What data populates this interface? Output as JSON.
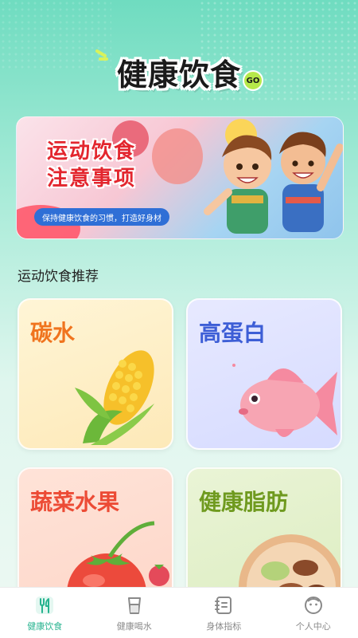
{
  "header": {
    "title": "健康饮食",
    "badge": "GO"
  },
  "banner": {
    "title_line1": "运动饮食",
    "title_line2": "注意事项",
    "subtitle": "保持健康饮食的习惯，打造好身材"
  },
  "section": {
    "title": "运动饮食推荐"
  },
  "cards": [
    {
      "label": "碳水",
      "icon": "corn"
    },
    {
      "label": "高蛋白",
      "icon": "fish"
    },
    {
      "label": "蔬菜水果",
      "icon": "tomato"
    },
    {
      "label": "健康脂肪",
      "icon": "nuts"
    }
  ],
  "tabbar": {
    "items": [
      {
        "label": "健康饮食",
        "icon": "fork-knife-icon"
      },
      {
        "label": "健康喝水",
        "icon": "cup-icon"
      },
      {
        "label": "身体指标",
        "icon": "notebook-icon"
      },
      {
        "label": "个人中心",
        "icon": "face-icon"
      }
    ],
    "active_index": 0,
    "active_color": "#27b38f",
    "inactive_color": "#8a8a8a"
  }
}
